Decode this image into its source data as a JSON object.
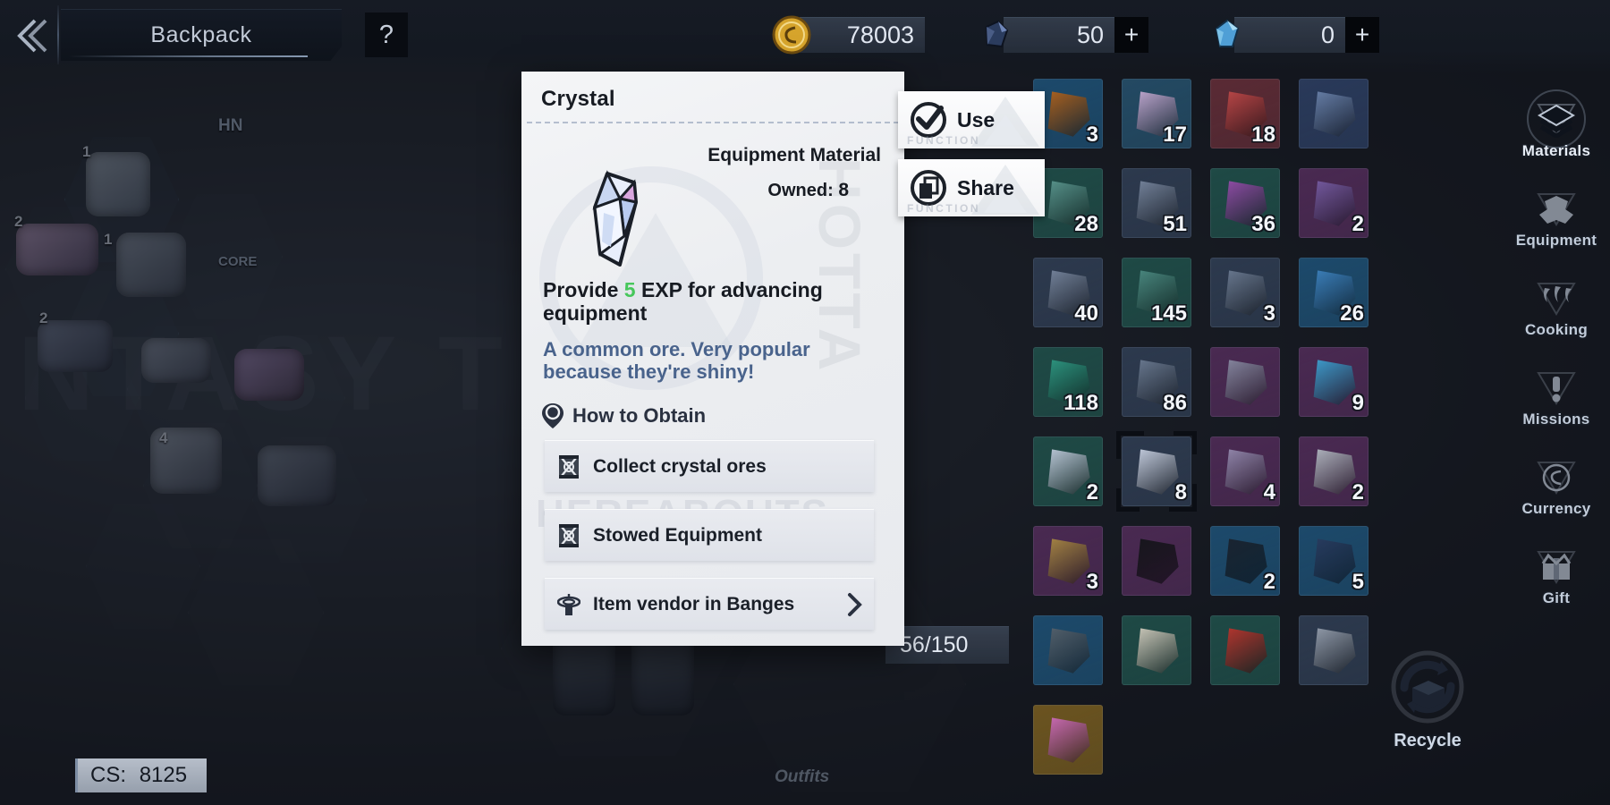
{
  "topbar": {
    "back_icon": "chevron-left-icon",
    "title": "Backpack",
    "help_label": "?",
    "currencies": [
      {
        "icon": "gold-coin-icon",
        "name": "Gold",
        "value": "78003",
        "has_plus": false,
        "plus_label": "+"
      },
      {
        "icon": "dark-crystal-icon",
        "name": "Dark Crystal",
        "value": "50",
        "has_plus": true,
        "plus_label": "+"
      },
      {
        "icon": "blue-gem-icon",
        "name": "Blue Gem",
        "value": "0",
        "has_plus": true,
        "plus_label": "+"
      }
    ]
  },
  "dialog": {
    "title": "Crystal",
    "item_icon": "crystal-icon",
    "watermark": "HOTTA",
    "background_text": "HEREABOUTS",
    "type_label": "Equipment Material",
    "owned_label": "Owned:",
    "owned_value": "8",
    "effect_prefix": "Provide",
    "effect_value": "5",
    "effect_suffix": "EXP for advancing equipment",
    "flavor": "A common ore. Very popular because they're shiny!",
    "obtain_heading": "How to Obtain",
    "obtain_heading_icon": "map-pin-icon",
    "obtain_rows": [
      {
        "label": "Collect crystal ores",
        "icon": "scroll-icon",
        "chevron": false
      },
      {
        "label": "Stowed Equipment",
        "icon": "scroll-icon",
        "chevron": false
      },
      {
        "label": "Item vendor in Banges",
        "icon": "tower-icon",
        "chevron": true
      }
    ]
  },
  "functions": [
    {
      "label": "Use",
      "icon": "check-circle-icon",
      "watermark": "FUNCTION"
    },
    {
      "label": "Share",
      "icon": "copy-circle-icon",
      "watermark": "FUNCTION"
    }
  ],
  "inventory": {
    "capacity": "56/150",
    "cells": [
      {
        "count": "3",
        "color": "#1d4a6b",
        "glyph": "#b5651d",
        "selected": false
      },
      {
        "count": "17",
        "color": "#244a63",
        "glyph": "#c9aed8",
        "selected": false
      },
      {
        "count": "18",
        "color": "#5a2b35",
        "glyph": "#c44a4a",
        "selected": false
      },
      {
        "count": "",
        "color": "#2a3a5a",
        "glyph": "#6d86b0",
        "selected": false
      },
      {
        "count": "28",
        "color": "#1f4a46",
        "glyph": "#5d9b93",
        "selected": false
      },
      {
        "count": "51",
        "color": "#2d3a4e",
        "glyph": "#7b8aa3",
        "selected": false
      },
      {
        "count": "36",
        "color": "#1f4a46",
        "glyph": "#9a4fb0",
        "selected": false
      },
      {
        "count": "2",
        "color": "#4a2a52",
        "glyph": "#7a5fa8",
        "selected": false
      },
      {
        "count": "40",
        "color": "#2d3a4e",
        "glyph": "#7b8aa3",
        "selected": false
      },
      {
        "count": "145",
        "color": "#1f4a46",
        "glyph": "#4e8f86",
        "selected": false
      },
      {
        "count": "3",
        "color": "#2d3a4e",
        "glyph": "#6f7f97",
        "selected": false
      },
      {
        "count": "26",
        "color": "#1d4a6b",
        "glyph": "#3f86c4",
        "selected": false
      },
      {
        "count": "118",
        "color": "#1f4a46",
        "glyph": "#2f9d86",
        "selected": false
      },
      {
        "count": "86",
        "color": "#2d3a4e",
        "glyph": "#6f7f97",
        "selected": false
      },
      {
        "count": "",
        "color": "#4a2a52",
        "glyph": "#8d8fa8",
        "selected": false
      },
      {
        "count": "9",
        "color": "#4a2a52",
        "glyph": "#3fa6d8",
        "selected": false
      },
      {
        "count": "2",
        "color": "#1f4a46",
        "glyph": "#c6d3e4",
        "selected": false
      },
      {
        "count": "8",
        "color": "#2d3a4e",
        "glyph": "#cfd8ea",
        "selected": true
      },
      {
        "count": "4",
        "color": "#4a2a52",
        "glyph": "#9a8fb5",
        "selected": false
      },
      {
        "count": "2",
        "color": "#4a2a52",
        "glyph": "#b9bfc9",
        "selected": false
      },
      {
        "count": "3",
        "color": "#4a2a52",
        "glyph": "#ae8c46",
        "selected": false
      },
      {
        "count": "",
        "color": "#4a2a52",
        "glyph": "#15161b",
        "selected": false
      },
      {
        "count": "2",
        "color": "#1d4a6b",
        "glyph": "#1b2430",
        "selected": false
      },
      {
        "count": "5",
        "color": "#1d4a6b",
        "glyph": "#2a3d62",
        "selected": false
      },
      {
        "count": "",
        "color": "#1d4a6b",
        "glyph": "#58646f",
        "selected": false
      },
      {
        "count": "",
        "color": "#1f4a46",
        "glyph": "#d8d3c4",
        "selected": false
      },
      {
        "count": "",
        "color": "#1f4a46",
        "glyph": "#c0362f",
        "selected": false
      },
      {
        "count": "",
        "color": "#2d3a4e",
        "glyph": "#9aa4b3",
        "selected": false
      },
      {
        "count": "",
        "color": "#6b5420",
        "glyph": "#d46fc0",
        "selected": false
      }
    ]
  },
  "sidenav": {
    "items": [
      {
        "label": "Materials",
        "icon": "layers-icon",
        "active": true
      },
      {
        "label": "Equipment",
        "icon": "armor-icon",
        "active": false
      },
      {
        "label": "Cooking",
        "icon": "flame-icon",
        "active": false
      },
      {
        "label": "Missions",
        "icon": "exclamation-icon",
        "active": false
      },
      {
        "label": "Currency",
        "icon": "s-coin-icon",
        "active": false
      },
      {
        "label": "Gift",
        "icon": "gift-box-icon",
        "active": false
      }
    ],
    "recycle": {
      "label": "Recycle",
      "icon": "recycle-icon"
    }
  },
  "world": {
    "outfits_label": "Outfits",
    "cs_label": "CS:",
    "cs_value": "8125",
    "backdrop_text": "NTASY T",
    "hex_labels": [
      "1",
      "2",
      "1",
      "2",
      "4",
      "HN",
      "CORE"
    ]
  }
}
